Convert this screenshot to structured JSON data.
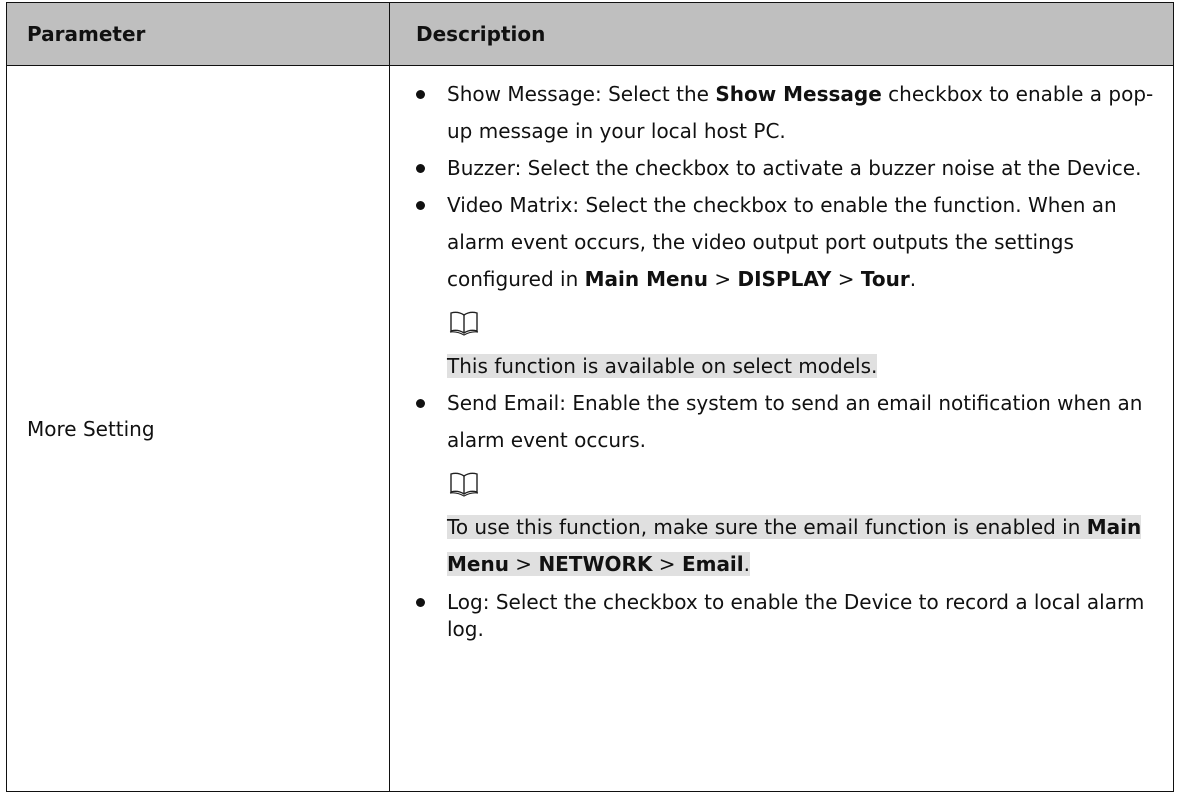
{
  "table": {
    "headers": {
      "parameter": "Parameter",
      "description": "Description"
    },
    "row": {
      "parameter": "More Setting",
      "items": {
        "show_message": {
          "lead": "Show Message: Select the ",
          "bold": "Show Message",
          "tail": " checkbox to enable a pop-up message in your local host PC."
        },
        "buzzer": {
          "text": "Buzzer: Select the checkbox to activate a buzzer noise at the Device."
        },
        "video_matrix": {
          "lead": "Video Matrix: Select the checkbox to enable the function. When an alarm event occurs, the video output port outputs the settings configured in ",
          "menu1": "Main Menu",
          "sep1": " > ",
          "menu2": "DISPLAY",
          "sep2": " > ",
          "menu3": "Tour",
          "end": "."
        },
        "note1": {
          "icon": "book-note-icon",
          "text": "This function is available on select models."
        },
        "send_email": {
          "text": "Send Email: Enable the system to send an email notification when an alarm event occurs."
        },
        "note2": {
          "icon": "book-note-icon",
          "lead": "To use this function, make sure the email function is enabled in ",
          "menu1": "Main Menu",
          "sep1": " > ",
          "menu2": "NETWORK",
          "sep2": " > ",
          "menu3": "Email",
          "end": "."
        },
        "log": {
          "text": "Log: Select the checkbox to enable the Device to record a local alarm log."
        }
      }
    }
  },
  "colors": {
    "header_bg": "#bfbfbf",
    "note_highlight": "#e0e0e0",
    "border": "#111111"
  }
}
